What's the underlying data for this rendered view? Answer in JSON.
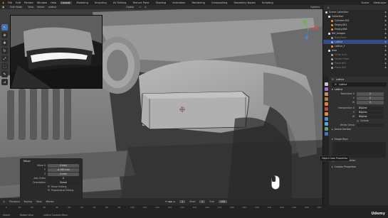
{
  "menu": {
    "items": [
      "File",
      "Edit",
      "Render",
      "Window",
      "Help"
    ],
    "workspaces": [
      "Layout",
      "Modeling",
      "Sculpting",
      "UV Editing",
      "Texture Paint",
      "Shading",
      "Animation",
      "Rendering",
      "Compositing",
      "Geometry Nodes",
      "Scripting"
    ],
    "active_workspace": "Layout",
    "scene": "Scene",
    "view_layer": "ViewLayer"
  },
  "viewport_header": {
    "mode": "Edit Mode",
    "menus": [
      "View",
      "Select",
      "Lattice"
    ],
    "orientation": "Global",
    "transform_label": "Options"
  },
  "operator_panel": {
    "title": "Move",
    "move_x": "0 mm",
    "move_y": "-0.363 mm",
    "move_z": "0 mm",
    "axis_ortho": "X",
    "orientation": "Global",
    "mirror_editing": "Mirror Editing",
    "proportional_editing": "Proportional Editing",
    "labels": {
      "move": "Move X",
      "y": "Y",
      "z": "Z",
      "axis_ortho": "Axis Ortho",
      "orientation": "Orientation"
    }
  },
  "outliner": {
    "title": "Scene Collection",
    "rows": [
      {
        "name": "Scene Collection",
        "color": "#cfcfcf",
        "dim": false,
        "sel": false
      },
      {
        "name": "Collection",
        "color": "#e0e0e0",
        "dim": false,
        "sel": false
      },
      {
        "name": "Cylinder.001",
        "color": "#e08c3c",
        "dim": false,
        "sel": false
      },
      {
        "name": "Empty.001",
        "color": "#e08c3c",
        "dim": false,
        "sel": false
      },
      {
        "name": "Empty.006",
        "color": "#e08c3c",
        "dim": false,
        "sel": false
      },
      {
        "name": "Ref_Images",
        "color": "#e0e0e0",
        "dim": false,
        "sel": false
      },
      {
        "name": "BodyFront",
        "color": "#9f9f9f",
        "dim": true,
        "sel": false
      },
      {
        "name": "Lattice",
        "color": "#7fb4ff",
        "dim": false,
        "sel": true
      },
      {
        "name": "Lattice_F",
        "color": "#e08c3c",
        "dim": false,
        "sel": false
      },
      {
        "name": "Jeep",
        "color": "#e0e0e0",
        "dim": false,
        "sel": false
      },
      {
        "name": "Grille Grid",
        "color": "#9f9f9f",
        "dim": true,
        "sel": false
      },
      {
        "name": "Fender Front",
        "color": "#9f9f9f",
        "dim": true,
        "sel": false
      },
      {
        "name": "Plane.001",
        "color": "#9f9f9f",
        "dim": true,
        "sel": false
      },
      {
        "name": "Plane.002",
        "color": "#9f9f9f",
        "dim": true,
        "sel": false
      }
    ]
  },
  "properties": {
    "object_name": "Lattice",
    "data_name": "Lattice",
    "section_lattice": "Lattice",
    "resolution_u_label": "Resolution U",
    "resolution_u": "2",
    "v_label": "V",
    "resolution_v": "2",
    "w_label": "W",
    "resolution_w": "2",
    "interp_u_label": "Interpolation U",
    "interp_u": "BSpline",
    "interp_v": "BSpline",
    "interp_w": "BSpline",
    "outside_label": "Outside",
    "vertex_group_label": "Vertex Group",
    "active_section": "Active Section",
    "tooltip": "Object Data Properties",
    "shape_keys": "Shape Keys",
    "add_rest": "Add Rest Position",
    "custom_props": "Custom Properties"
  },
  "timeline": {
    "menus": [
      "Playback",
      "Keying",
      "View",
      "Marker"
    ],
    "current_frame": "1",
    "start_label": "Start",
    "start": "1",
    "end_label": "End",
    "end": "250",
    "ruler_ticks": [
      "0",
      "10",
      "20",
      "30",
      "40",
      "50",
      "60",
      "70",
      "80",
      "90",
      "100",
      "110",
      "120",
      "130",
      "140",
      "150",
      "160",
      "170",
      "180",
      "190",
      "200",
      "210",
      "220",
      "230",
      "240",
      "250"
    ]
  },
  "status": {
    "items": [
      "Select",
      "Rotate View",
      "Lattice Context Menu"
    ]
  },
  "watermark": "Udemy",
  "colors": {
    "accent": "#4772b3",
    "selected_row": "#334d80"
  }
}
